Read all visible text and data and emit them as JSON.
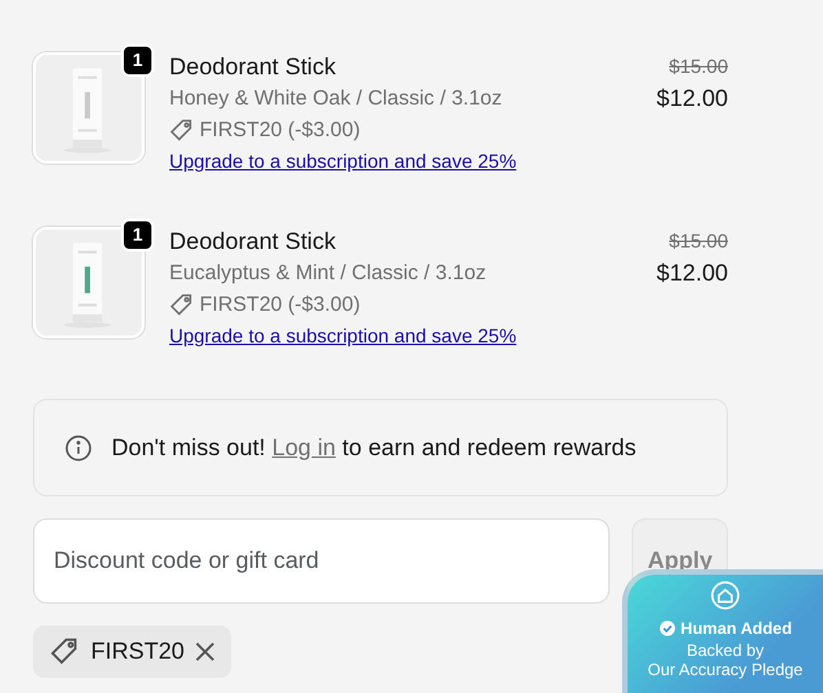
{
  "items": [
    {
      "quantity": "1",
      "title": "Deodorant Stick",
      "variant": "Honey & White Oak / Classic / 3.1oz",
      "discount": "FIRST20 (-$3.00)",
      "upgrade_link": "Upgrade to a subscription and save 25%",
      "original_price": "$15.00",
      "price": "$12.00"
    },
    {
      "quantity": "1",
      "title": "Deodorant Stick",
      "variant": "Eucalyptus & Mint / Classic / 3.1oz",
      "discount": "FIRST20 (-$3.00)",
      "upgrade_link": "Upgrade to a subscription and save 25%",
      "original_price": "$15.00",
      "price": "$12.00"
    }
  ],
  "rewards": {
    "lead": "Don't miss out!",
    "link": "Log in",
    "rest": "to earn and redeem rewards"
  },
  "discount_field": {
    "placeholder": "Discount code or gift card"
  },
  "apply_button": {
    "label": "Apply",
    "disabled": true
  },
  "applied_codes": [
    {
      "code": "FIRST20"
    }
  ],
  "badge": {
    "title": "Human Added",
    "line_1": "Backed by",
    "line_2": "Our Accuracy Pledge"
  }
}
